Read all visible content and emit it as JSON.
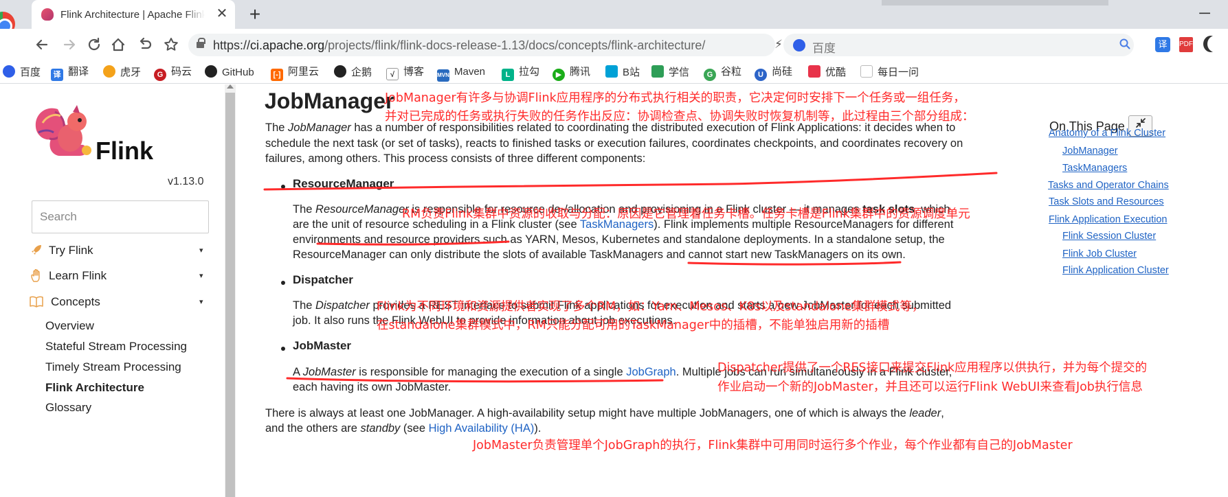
{
  "browser": {
    "tab_title": "Flink Architecture | Apache Flink",
    "tab_close": "✕",
    "new_tab": "+",
    "url": {
      "scheme": "https://",
      "host": "ci.apache.org",
      "path": "/projects/flink/flink-docs-release-1.13/docs/concepts/flink-architecture/"
    },
    "search_engine_label": "百度",
    "bookmarks": [
      "百度",
      "翻译",
      "虎牙",
      "码云",
      "GitHub",
      "阿里云",
      "企鹅",
      "博客",
      "Maven",
      "拉勾",
      "腾讯",
      "B站",
      "学信",
      "谷粒",
      "尚硅",
      "优酷",
      "每日一问"
    ]
  },
  "sidebar": {
    "logo_text": "Flink",
    "version": "v1.13.0",
    "search_placeholder": "Search",
    "sections": [
      {
        "label": "Try Flink",
        "caret": "▾"
      },
      {
        "label": "Learn Flink",
        "caret": "▾"
      },
      {
        "label": "Concepts",
        "caret": "▾"
      }
    ],
    "concepts_items": [
      {
        "label": "Overview"
      },
      {
        "label": "Stateful Stream Processing"
      },
      {
        "label": "Timely Stream Processing"
      },
      {
        "label": "Flink Architecture"
      },
      {
        "label": "Glossary"
      }
    ]
  },
  "content": {
    "heading": "JobManager",
    "intro": {
      "l1_a": "The ",
      "l1_em": "JobManager",
      "l1_b": " has a number of responsibilities related to coordinating the distributed execution of Flink Applications: it decides when to",
      "l2": "schedule the next task (or set of tasks), reacts to finished tasks or execution failures, coordinates checkpoints, and coordinates recovery on",
      "l3": "failures, among others. This process consists of three different components:"
    },
    "resource_manager": {
      "title": "ResourceManager",
      "l1_a": "The ",
      "l1_em": "ResourceManager",
      "l1_b": " is responsible for resource de-/allocation and provisioning in a Flink cluster — it manages ",
      "l1_bold": "task slots",
      "l1_c": ", which",
      "l2_a": "are the unit of resource scheduling in a Flink cluster (see ",
      "l2_link": "TaskManagers",
      "l2_b": "). Flink implements multiple ResourceManagers for different",
      "l3": "environments and resource providers such as YARN, Mesos, Kubernetes and standalone deployments. In a standalone setup, the",
      "l4": "ResourceManager can only distribute the slots of available TaskManagers and cannot start new TaskManagers on its own."
    },
    "dispatcher": {
      "title": "Dispatcher",
      "l1_a": "The ",
      "l1_em": "Dispatcher",
      "l1_b": " provides a REST interface to submit Flink applications for execution and starts a new JobMaster for each submitted",
      "l2": "job. It also runs the Flink WebUI to provide information about job executions."
    },
    "jobmaster": {
      "title": "JobMaster",
      "l1_a": "A ",
      "l1_em": "JobMaster",
      "l1_b": " is responsible for managing the execution of a single ",
      "l1_link": "JobGraph",
      "l1_c": ". Multiple jobs can run simultaneously in a Flink cluster,",
      "l2": "each having its own JobMaster."
    },
    "footer": {
      "l1_a": "There is always at least one JobManager. A high-availability setup might have multiple JobManagers, one of which is always the ",
      "l1_em": "leader",
      "l1_b": ",",
      "l2_a": "and the others are ",
      "l2_em": "standby",
      "l2_b": " (see ",
      "l2_link": "High Availability (HA)",
      "l2_c": ")."
    }
  },
  "toc": {
    "title": "On This Page",
    "collapse_icon": "compress-icon",
    "items": [
      {
        "label": "Anatomy of a Flink Cluster"
      },
      {
        "label": "JobManager"
      },
      {
        "label": "TaskManagers"
      },
      {
        "label": "Tasks and Operator Chains"
      },
      {
        "label": "Task Slots and Resources"
      },
      {
        "label": "Flink Application Execution"
      },
      {
        "label": "Flink Session Cluster"
      },
      {
        "label": "Flink Job Cluster"
      },
      {
        "label": "Flink Application Cluster"
      }
    ]
  },
  "annotations": {
    "color": "#ff2a2a",
    "jm_1": "JobManager有许多与协调Flink应用程序的分布式执行相关的职责，它决定何时安排下一个任务或一组任务，",
    "jm_2": "并对已完成的任务或执行失败的任务作出反应：协调检查点、协调失败时恢复机制等，此过程由三个部分组成：",
    "rm": "RM负责Flink集群中资源的收取与分配：原因是它管理着任务卡槽。任务卡槽是Flink集群中的资源调度单元",
    "flink_1": "Flink为不同环境和资源提供者实现了多个RM，如：Yarn、Mesos、K8s以及standalone集群模式等，",
    "flink_2": "在standalone集群模式中，RM只能分配可用的TaskManager中的插槽，不能单独启用新的插槽",
    "disp_1": "Dispatcher提供了一个RES接口来提交Flink应用程序以供执行，并为每个提交的",
    "disp_2": "作业启动一个新的JobMaster，并且还可以运行Flink WebUI来查看Job执行信息",
    "jobm": "JobMaster负责管理单个JobGraph的执行，Flink集群中可用同时运行多个作业，每个作业都有自己的JobMaster"
  }
}
